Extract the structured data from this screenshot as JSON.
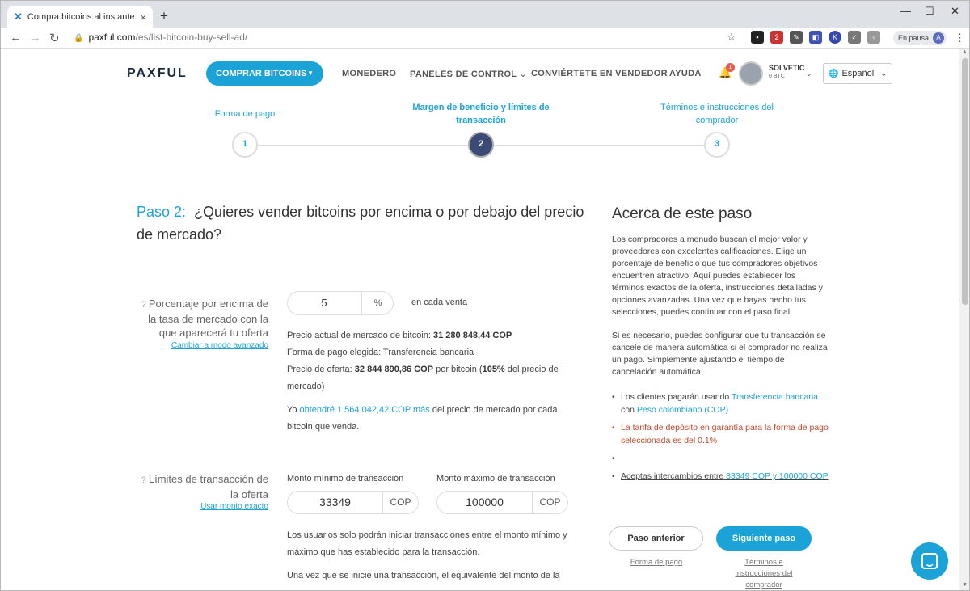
{
  "browser": {
    "tab_title": "Compra bitcoins al instante | Pax",
    "tab_favicon": "paxful-icon",
    "url_domain": "paxful.com",
    "url_path": "/es/list-bitcoin-buy-sell-ad/",
    "paused_label": "En pausa",
    "profile_initial": "A",
    "ext_badge": "2"
  },
  "header": {
    "logo": "PAXFUL",
    "buy_button": "COMPRAR BITCOINS",
    "nav": [
      "MONEDERO",
      "PANELES DE CONTROL",
      "CONVIÉRTETE EN VENDEDOR",
      "AYUDA"
    ],
    "notif_count": "1",
    "username": "SOLVETIC",
    "balance": "0 BTC",
    "language": "Español"
  },
  "stepper": {
    "steps": [
      {
        "label": "Forma de pago",
        "number": "1"
      },
      {
        "label": "Margen de beneficio y límites de transacción",
        "number": "2"
      },
      {
        "label": "Términos e instrucciones del comprador",
        "number": "3"
      }
    ],
    "active_step": 2
  },
  "main": {
    "step_prefix": "Paso 2:",
    "title": "¿Quieres vender bitcoins por encima o por debajo del precio de mercado?",
    "margin": {
      "label": "Porcentaje por encima de la tasa de mercado con la que aparecerá tu oferta",
      "advanced_link": "Cambiar a modo avanzado",
      "value": "5",
      "unit": "%",
      "side_text": "en cada venta",
      "market_price_label": "Precio actual de mercado de bitcoin:",
      "market_price": "31 280 848,44 COP",
      "payment_label": "Forma de pago elegida:",
      "payment_method": "Transferencia bancaria",
      "offer_price_label": "Precio de oferta:",
      "offer_price": "32 844 890,86 COP",
      "offer_price_mid": "por bitcoin (",
      "offer_pct": "105%",
      "offer_price_tail": "del precio de mercado)",
      "earn_prefix": "Yo",
      "earn_link": "obtendré 1 564 042,42 COP más",
      "earn_suffix": "del precio de mercado por cada bitcoin que venda."
    },
    "limits": {
      "label": "Límites de transacción de la oferta",
      "exact_link": "Usar monto exacto",
      "min_label": "Monto mínimo de transacción",
      "min_value": "33349",
      "max_label": "Monto máximo de transacción",
      "max_value": "100000",
      "currency": "COP",
      "note1": "Los usuarios solo podrán iniciar transacciones entre el monto mínimo y máximo que has establecido para la transacción.",
      "note2": "Una vez que se inicie una transacción, el equivalente del monto de la"
    }
  },
  "sidebar": {
    "heading": "Acerca de este paso",
    "para1": "Los compradores a menudo buscan el mejor valor y proveedores con excelentes calificaciones. Elige un porcentaje de beneficio que tus compradores objetivos encuentren atractivo. Aquí puedes establecer los términos exactos de la oferta, instrucciones detalladas y opciones avanzadas. Una vez que hayas hecho tus selecciones, puedes continuar con el paso final.",
    "para2": "Si es necesario, puedes configurar que tu transacción se cancele de manera automática si el comprador no realiza un pago. Simplemente ajustando el tiempo de cancelación automática.",
    "bullet1_prefix": "Los clientes pagarán usando",
    "bullet1_link1": "Transferencia bancaria",
    "bullet1_mid": "con",
    "bullet1_link2": "Peso colombiano (COP)",
    "bullet2": "La tarifa de depósito en garantía para la forma de pago seleccionada es del 0.1%",
    "bullet4_prefix": "Aceptas intercambios entre",
    "bullet4_link": "33349 COP y 100000 COP",
    "prev_button": "Paso anterior",
    "next_button": "Siguiente paso",
    "prev_sub": "Forma de pago",
    "next_sub": "Términos e instrucciones del comprador"
  },
  "colors": {
    "accent": "#1ba3d8",
    "active_step": "#3c4a77",
    "warning": "#c0492a"
  }
}
